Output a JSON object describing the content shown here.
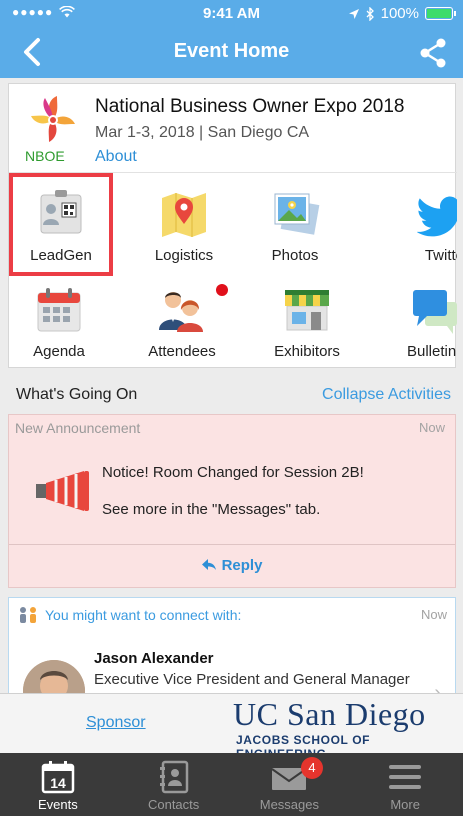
{
  "status": {
    "time": "9:41 AM",
    "battery": "100%"
  },
  "nav": {
    "title": "Event Home"
  },
  "event": {
    "logo_text": "NBOE",
    "title": "National Business Owner Expo 2018",
    "dates": "Mar 1-3, 2018 | San Diego CA",
    "about": "About"
  },
  "tiles": [
    {
      "label": "LeadGen",
      "icon": "badge-qr-icon"
    },
    {
      "label": "Logistics",
      "icon": "map-pin-icon"
    },
    {
      "label": "Photos",
      "icon": "photos-icon"
    },
    {
      "label": "Twitter",
      "icon": "twitter-icon"
    },
    {
      "label": "Agenda",
      "icon": "calendar-icon"
    },
    {
      "label": "Attendees",
      "icon": "people-icon"
    },
    {
      "label": "Exhibitors",
      "icon": "storefront-icon"
    },
    {
      "label": "Bulletin",
      "icon": "chat-bubbles-icon"
    }
  ],
  "activities": {
    "heading": "What's Going On",
    "collapse": "Collapse Activities",
    "announcement": {
      "type": "New Announcement",
      "time": "Now",
      "line1": "Notice! Room Changed for Session 2B!",
      "line2": "See more in the \"Messages\" tab.",
      "reply": "Reply"
    },
    "connect": {
      "heading": "You might want to connect with:",
      "time": "Now",
      "name": "Jason Alexander",
      "role": "Executive Vice President and General Manager"
    }
  },
  "sponsor": {
    "label": "Sponsor",
    "logo_title": "UC San Diego",
    "logo_subtitle": "JACOBS SCHOOL OF ENGINEERING"
  },
  "tabs": [
    {
      "label": "Events",
      "icon": "calendar-14-icon",
      "day": "14"
    },
    {
      "label": "Contacts",
      "icon": "address-book-icon"
    },
    {
      "label": "Messages",
      "icon": "envelope-icon",
      "badge": "4"
    },
    {
      "label": "More",
      "icon": "hamburger-icon"
    }
  ],
  "colors": {
    "header": "#5aace8",
    "accent": "#2e8fd6",
    "highlight": "#ec3d45",
    "announcement_bg": "#fbe3e3",
    "tabbar": "#3a3a3a"
  }
}
